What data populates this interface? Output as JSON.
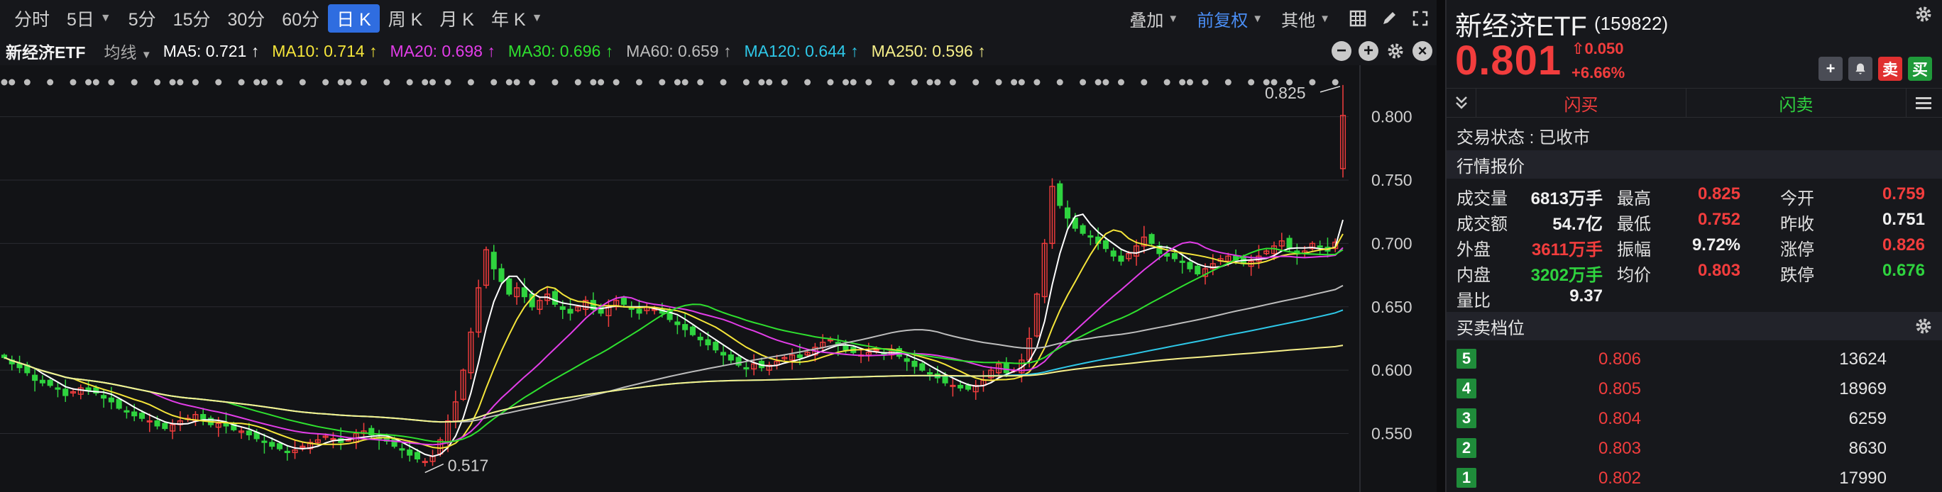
{
  "toolbar": {
    "periods": [
      {
        "label": "分时",
        "active": false,
        "dropdown": false
      },
      {
        "label": "5日",
        "active": false,
        "dropdown": true
      },
      {
        "label": "5分",
        "active": false,
        "dropdown": false
      },
      {
        "label": "15分",
        "active": false,
        "dropdown": false
      },
      {
        "label": "30分",
        "active": false,
        "dropdown": false
      },
      {
        "label": "60分",
        "active": false,
        "dropdown": false
      },
      {
        "label": "日 K",
        "active": true,
        "dropdown": false
      },
      {
        "label": "周 K",
        "active": false,
        "dropdown": false
      },
      {
        "label": "月 K",
        "active": false,
        "dropdown": false
      },
      {
        "label": "年 K",
        "active": false,
        "dropdown": true
      }
    ],
    "overlay_label": "叠加",
    "adjust_label": "前复权",
    "other_label": "其他"
  },
  "ma_bar": {
    "name": "新经济ETF",
    "line_type": "均线",
    "items": [
      {
        "text": "MA5: 0.721 ↑",
        "color": "#ffffff"
      },
      {
        "text": "MA10: 0.714 ↑",
        "color": "#f5e53a"
      },
      {
        "text": "MA20: 0.698 ↑",
        "color": "#e23de8"
      },
      {
        "text": "MA30: 0.696 ↑",
        "color": "#2fe02f"
      },
      {
        "text": "MA60: 0.659 ↑",
        "color": "#bdbdbd"
      },
      {
        "text": "MA120: 0.644 ↑",
        "color": "#2ec8e8"
      },
      {
        "text": "MA250: 0.596 ↑",
        "color": "#f7f08a"
      }
    ]
  },
  "chart_data": {
    "type": "candlestick",
    "y_ticks": [
      "0.800",
      "0.750",
      "0.700",
      "0.650",
      "0.600",
      "0.550"
    ],
    "ylim": [
      0.505,
      0.835
    ],
    "high_label": "0.825",
    "low_label": "0.517",
    "up_color": "#f23d3d",
    "down_color": "#2fd33f",
    "close": [
      0.61,
      0.605,
      0.602,
      0.598,
      0.592,
      0.59,
      0.588,
      0.585,
      0.58,
      0.583,
      0.586,
      0.584,
      0.582,
      0.578,
      0.575,
      0.57,
      0.567,
      0.564,
      0.562,
      0.56,
      0.556,
      0.554,
      0.557,
      0.56,
      0.562,
      0.565,
      0.56,
      0.557,
      0.558,
      0.556,
      0.553,
      0.552,
      0.549,
      0.546,
      0.543,
      0.54,
      0.538,
      0.535,
      0.537,
      0.54,
      0.543,
      0.545,
      0.548,
      0.546,
      0.543,
      0.545,
      0.55,
      0.552,
      0.549,
      0.546,
      0.544,
      0.54,
      0.537,
      0.533,
      0.53,
      0.528,
      0.532,
      0.545,
      0.56,
      0.575,
      0.6,
      0.63,
      0.665,
      0.695,
      0.68,
      0.67,
      0.66,
      0.665,
      0.658,
      0.65,
      0.655,
      0.66,
      0.652,
      0.648,
      0.645,
      0.65,
      0.655,
      0.648,
      0.645,
      0.65,
      0.655,
      0.652,
      0.648,
      0.645,
      0.65,
      0.648,
      0.645,
      0.64,
      0.636,
      0.632,
      0.628,
      0.624,
      0.62,
      0.616,
      0.612,
      0.608,
      0.604,
      0.601,
      0.605,
      0.602,
      0.604,
      0.607,
      0.61,
      0.612,
      0.61,
      0.614,
      0.618,
      0.622,
      0.624,
      0.62,
      0.616,
      0.614,
      0.612,
      0.614,
      0.616,
      0.612,
      0.615,
      0.611,
      0.607,
      0.603,
      0.6,
      0.597,
      0.594,
      0.59,
      0.588,
      0.586,
      0.585,
      0.588,
      0.592,
      0.6,
      0.605,
      0.598,
      0.6,
      0.608,
      0.625,
      0.66,
      0.7,
      0.745,
      0.73,
      0.72,
      0.712,
      0.708,
      0.705,
      0.7,
      0.696,
      0.69,
      0.686,
      0.692,
      0.698,
      0.705,
      0.7,
      0.692,
      0.69,
      0.688,
      0.685,
      0.68,
      0.676,
      0.68,
      0.684,
      0.688,
      0.69,
      0.687,
      0.684,
      0.686,
      0.69,
      0.694,
      0.698,
      0.702,
      0.696,
      0.692,
      0.694,
      0.7,
      0.697,
      0.694,
      0.701
    ],
    "last_candle": {
      "open": 0.759,
      "high": 0.825,
      "low": 0.752,
      "close": 0.801
    }
  },
  "quote": {
    "name": "新经济ETF",
    "code": "(159822)",
    "price": "0.801",
    "change": "0.050",
    "change_pct": "+6.66%",
    "flash_buy": "闪买",
    "flash_sell": "闪卖",
    "trade_status": "交易状态 : 已收市",
    "section_quote": "行情报价",
    "section_orderbook": "买卖档位",
    "rows": [
      {
        "l1": "成交量",
        "v1": "6813万手",
        "c1": "#f0f0f0",
        "l2": "最高",
        "v2": "0.825",
        "c2": "#f23d3d",
        "l3": "今开",
        "v3": "0.759",
        "c3": "#f23d3d"
      },
      {
        "l1": "成交额",
        "v1": "54.7亿",
        "c1": "#f0f0f0",
        "l2": "最低",
        "v2": "0.752",
        "c2": "#f23d3d",
        "l3": "昨收",
        "v3": "0.751",
        "c3": "#f0f0f0"
      },
      {
        "l1": "外盘",
        "v1": "3611万手",
        "c1": "#f23d3d",
        "l2": "振幅",
        "v2": "9.72%",
        "c2": "#f0f0f0",
        "l3": "涨停",
        "v3": "0.826",
        "c3": "#f23d3d"
      },
      {
        "l1": "内盘",
        "v1": "3202万手",
        "c1": "#2fd33f",
        "l2": "均价",
        "v2": "0.803",
        "c2": "#f23d3d",
        "l3": "跌停",
        "v3": "0.676",
        "c3": "#2fd33f"
      },
      {
        "l1": "量比",
        "v1": "9.37",
        "c1": "#f0f0f0",
        "l2": "",
        "v2": "",
        "c2": "#f0f0f0",
        "l3": "",
        "v3": "",
        "c3": "#f0f0f0"
      }
    ],
    "orderbook": [
      {
        "level": "5",
        "price": "0.806",
        "volume": "13624"
      },
      {
        "level": "4",
        "price": "0.805",
        "volume": "18969"
      },
      {
        "level": "3",
        "price": "0.804",
        "volume": "6259"
      },
      {
        "level": "2",
        "price": "0.803",
        "volume": "8630"
      },
      {
        "level": "1",
        "price": "0.802",
        "volume": "17990"
      }
    ],
    "btn_buy": "买",
    "btn_sell": "卖"
  }
}
